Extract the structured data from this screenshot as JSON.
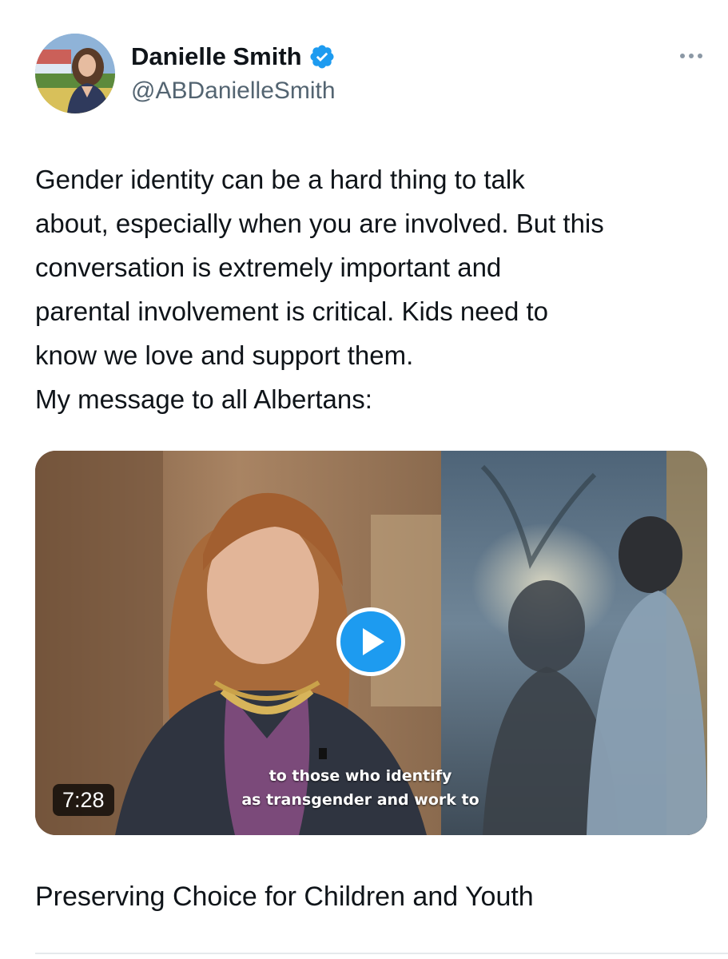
{
  "author": {
    "display_name": "Danielle Smith",
    "handle": "@ABDanielleSmith",
    "verified": true,
    "avatar_icon": "profile-photo"
  },
  "tweet": {
    "text": "Gender identity can be a hard thing to talk\nabout, especially when you are involved. But this\nconversation is extremely important and\nparental involvement is critical. Kids need to\nknow we love and support them.\nMy message to all Albertans:"
  },
  "video": {
    "duration": "7:28",
    "caption_line1": "to those who identify",
    "caption_line2": "as transgender and work to",
    "play_icon": "play-icon"
  },
  "link_card": {
    "title": "Preserving Choice for Children and Youth"
  },
  "colors": {
    "accent": "#1d9bf0",
    "text": "#0f1419",
    "secondary_text": "#536471"
  }
}
